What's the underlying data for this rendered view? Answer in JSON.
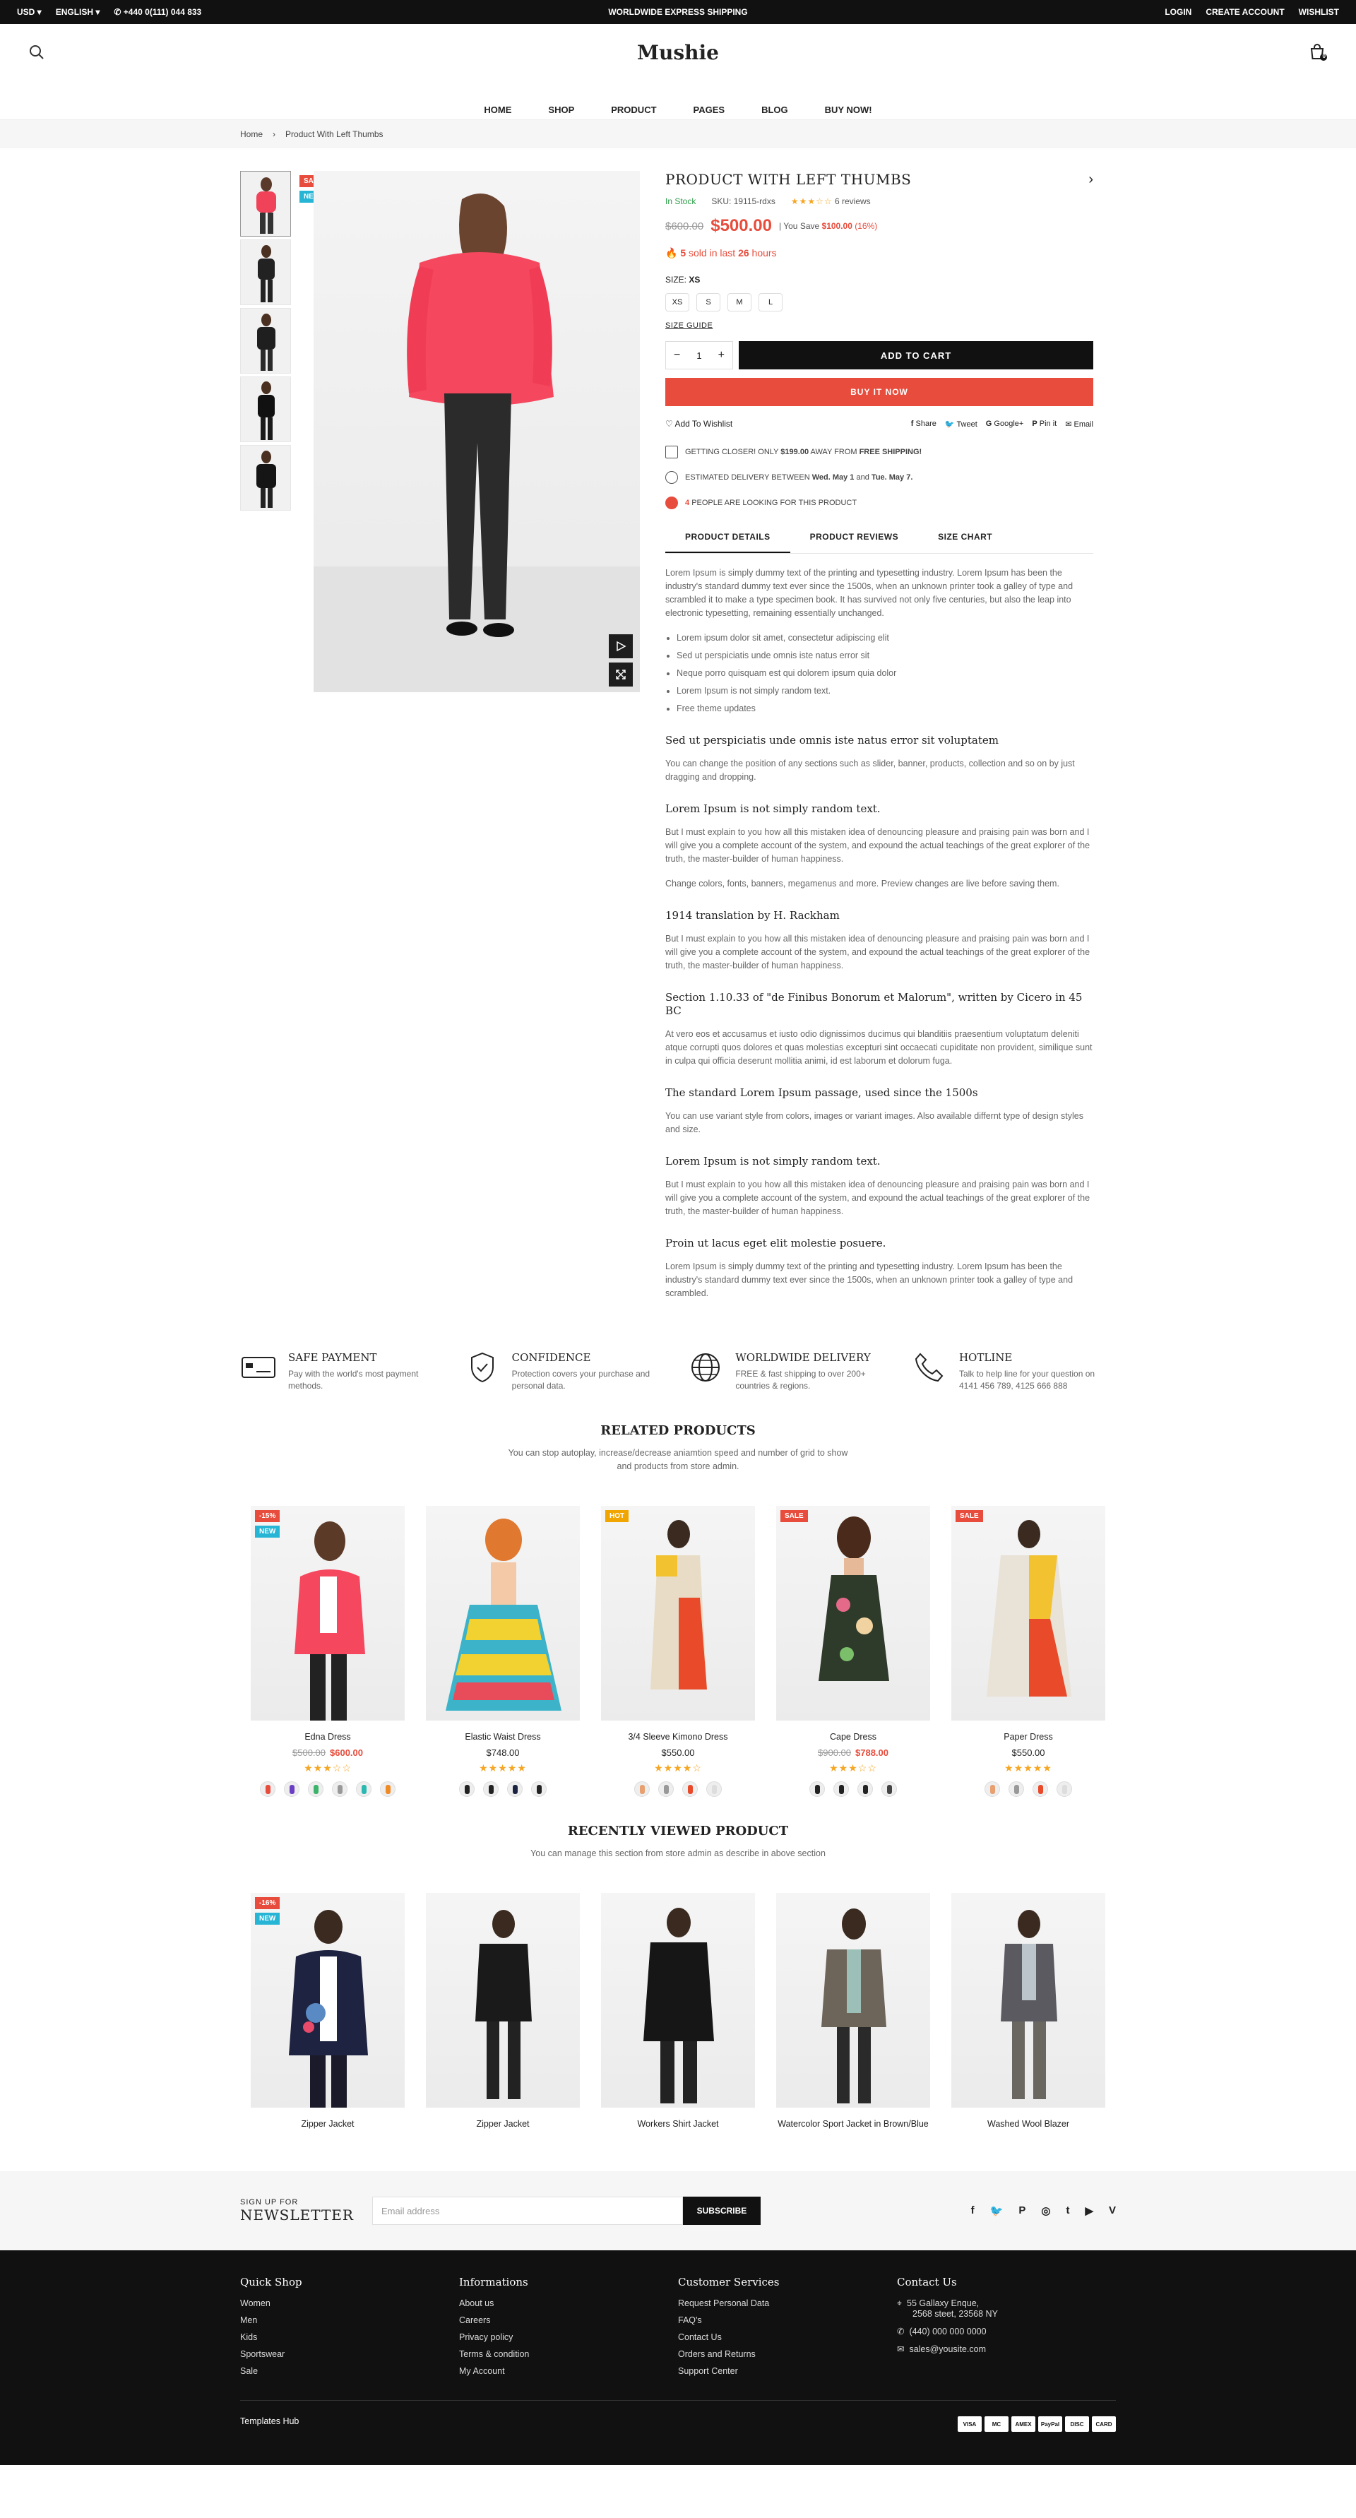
{
  "topbar": {
    "currency": "USD",
    "language": "ENGLISH",
    "phone": "+440 0(111) 044 833",
    "promo": "WORLDWIDE EXPRESS SHIPPING",
    "login": "LOGIN",
    "create_account": "CREATE ACCOUNT",
    "wishlist": "WISHLIST"
  },
  "header": {
    "logo": "Mushie",
    "cart_count": "0",
    "nav": [
      "HOME",
      "SHOP",
      "PRODUCT",
      "PAGES",
      "BLOG",
      "BUY NOW!"
    ]
  },
  "breadcrumb": {
    "home": "Home",
    "sep": "›",
    "current": "Product With Left Thumbs"
  },
  "product": {
    "badges": {
      "sale": "SALE",
      "new": "NEW"
    },
    "title": "PRODUCT WITH LEFT THUMBS",
    "stock": "In Stock",
    "sku": "SKU: 19115-rdxs",
    "stars": "★★★☆☆",
    "reviews": "6 reviews",
    "old_price": "$600.00",
    "price": "$500.00",
    "save_prefix": "You Save",
    "save_amount": "$100.00",
    "save_pct": "(16%)",
    "sold_count": "5",
    "sold_mid": "sold in last",
    "sold_hours": "26",
    "sold_suffix": "hours",
    "size_label": "SIZE:",
    "size_value": "XS",
    "sizes": [
      "XS",
      "S",
      "M",
      "L"
    ],
    "size_guide": "SIZE GUIDE",
    "qty": "1",
    "add_to_cart": "ADD TO CART",
    "buy_now": "BUY IT NOW",
    "wishlist": "Add To Wishlist",
    "share": [
      "Share",
      "Tweet",
      "Google+",
      "Pin it",
      "Email"
    ],
    "notes": {
      "shipping_a": "GETTING CLOSER! ONLY",
      "shipping_amount": "$199.00",
      "shipping_b": "AWAY FROM",
      "shipping_c": "FREE SHIPPING!",
      "delivery_a": "ESTIMATED DELIVERY BETWEEN",
      "delivery_from": "Wed. May 1",
      "delivery_and": "and",
      "delivery_to": "Tue. May 7.",
      "viewers_count": "4",
      "viewers_text": "PEOPLE ARE LOOKING FOR THIS PRODUCT"
    },
    "tabs": [
      "PRODUCT DETAILS",
      "PRODUCT REVIEWS",
      "SIZE CHART"
    ]
  },
  "description": {
    "intro": "Lorem Ipsum is simply dummy text of the printing and typesetting industry. Lorem Ipsum has been the industry's standard dummy text ever since the 1500s, when an unknown printer took a galley of type and scrambled it to make a type specimen book. It has survived not only five centuries, but also the leap into electronic typesetting, remaining essentially unchanged.",
    "bullets": [
      "Lorem ipsum dolor sit amet, consectetur adipiscing elit",
      "Sed ut perspiciatis unde omnis iste natus error sit",
      "Neque porro quisquam est qui dolorem ipsum quia dolor",
      "Lorem Ipsum is not simply random text.",
      "Free theme updates"
    ],
    "h1": "Sed ut perspiciatis unde omnis iste natus error sit voluptatem",
    "p1": "You can change the position of any sections such as slider, banner, products, collection and so on by just dragging and dropping.",
    "h2": "Lorem Ipsum is not simply random text.",
    "p2": "But I must explain to you how all this mistaken idea of denouncing pleasure and praising pain was born and I will give you a complete account of the system, and expound the actual teachings of the great explorer of the truth, the master-builder of human happiness.",
    "p2b": "Change colors, fonts, banners, megamenus and more. Preview changes are live before saving them.",
    "h3": "1914 translation by H. Rackham",
    "p3": "But I must explain to you how all this mistaken idea of denouncing pleasure and praising pain was born and I will give you a complete account of the system, and expound the actual teachings of the great explorer of the truth, the master-builder of human happiness.",
    "h4": "Section 1.10.33 of \"de Finibus Bonorum et Malorum\", written by Cicero in 45 BC",
    "p4": "At vero eos et accusamus et iusto odio dignissimos ducimus qui blanditiis praesentium voluptatum deleniti atque corrupti quos dolores et quas molestias excepturi sint occaecati cupiditate non provident, similique sunt in culpa qui officia deserunt mollitia animi, id est laborum et dolorum fuga.",
    "h5": "The standard Lorem Ipsum passage, used since the 1500s",
    "p5": "You can use variant style from colors, images or variant images. Also available differnt type of design styles and size.",
    "h6": "Lorem Ipsum is not simply random text.",
    "p6": "But I must explain to you how all this mistaken idea of denouncing pleasure and praising pain was born and I will give you a complete account of the system, and expound the actual teachings of the great explorer of the truth, the master-builder of human happiness.",
    "h7": "Proin ut lacus eget elit molestie posuere.",
    "p7": "Lorem Ipsum is simply dummy text of the printing and typesetting industry. Lorem Ipsum has been the industry's standard dummy text ever since the 1500s, when an unknown printer took a galley of type and scrambled."
  },
  "features": [
    {
      "title": "SAFE PAYMENT",
      "text": "Pay with the world's most payment methods."
    },
    {
      "title": "CONFIDENCE",
      "text": "Protection covers your purchase and personal data."
    },
    {
      "title": "WORLDWIDE DELIVERY",
      "text": "FREE & fast shipping to over 200+ countries & regions."
    },
    {
      "title": "HOTLINE",
      "text": "Talk to help line for your question on 4141 456 789, 4125 666 888"
    }
  ],
  "related": {
    "title": "RELATED PRODUCTS",
    "subtitle": "You can stop autoplay, increase/decrease aniamtion speed and number of grid to show and products from store admin.",
    "items": [
      {
        "name": "Edna Dress",
        "old": "$500.00",
        "price": "$600.00",
        "stars": "★★★☆☆",
        "badge1": "-15%",
        "badge2": "NEW"
      },
      {
        "name": "Elastic Waist Dress",
        "old": "",
        "price": "$748.00",
        "stars": "★★★★★",
        "badge1": "",
        "badge2": ""
      },
      {
        "name": "3/4 Sleeve Kimono Dress",
        "old": "",
        "price": "$550.00",
        "stars": "★★★★☆",
        "badge1": "HOT",
        "badge2": ""
      },
      {
        "name": "Cape Dress",
        "old": "$900.00",
        "price": "$788.00",
        "stars": "★★★☆☆",
        "badge1": "SALE",
        "badge2": ""
      },
      {
        "name": "Paper Dress",
        "old": "",
        "price": "$550.00",
        "stars": "★★★★★",
        "badge1": "SALE",
        "badge2": ""
      }
    ]
  },
  "recent": {
    "title": "RECENTLY VIEWED PRODUCT",
    "subtitle": "You can manage this section from store admin as describe in above section",
    "items": [
      {
        "name": "Zipper Jacket",
        "badge1": "-16%",
        "badge2": "NEW"
      },
      {
        "name": "Zipper Jacket"
      },
      {
        "name": "Workers Shirt Jacket"
      },
      {
        "name": "Watercolor Sport Jacket in Brown/Blue"
      },
      {
        "name": "Washed Wool Blazer"
      }
    ]
  },
  "newsletter": {
    "small": "SIGN UP FOR",
    "big": "NEWSLETTER",
    "placeholder": "Email address",
    "button": "SUBSCRIBE",
    "socials": [
      "f",
      "🐦",
      "P",
      "◎",
      "t",
      "▶",
      "V"
    ]
  },
  "footer": {
    "cols": [
      {
        "title": "Quick Shop",
        "links": [
          "Women",
          "Men",
          "Kids",
          "Sportswear",
          "Sale"
        ]
      },
      {
        "title": "Informations",
        "links": [
          "About us",
          "Careers",
          "Privacy policy",
          "Terms & condition",
          "My Account"
        ]
      },
      {
        "title": "Customer Services",
        "links": [
          "Request Personal Data",
          "FAQ's",
          "Contact Us",
          "Orders and Returns",
          "Support Center"
        ]
      }
    ],
    "contact": {
      "title": "Contact Us",
      "address1": "55 Gallaxy Enque,",
      "address2": "2568 steet, 23568 NY",
      "phone": "(440) 000 000 0000",
      "email": "sales@yousite.com"
    },
    "copyright": "Templates Hub",
    "payments": [
      "VISA",
      "MC",
      "AMEX",
      "PayPal",
      "DISC",
      "CARD"
    ]
  },
  "colors": {
    "accent": "#e74c3c",
    "dark": "#111111",
    "stock": "#2d9b48",
    "stars": "#f5a623",
    "new_badge": "#27b5d6",
    "hot_badge": "#f0a500"
  }
}
